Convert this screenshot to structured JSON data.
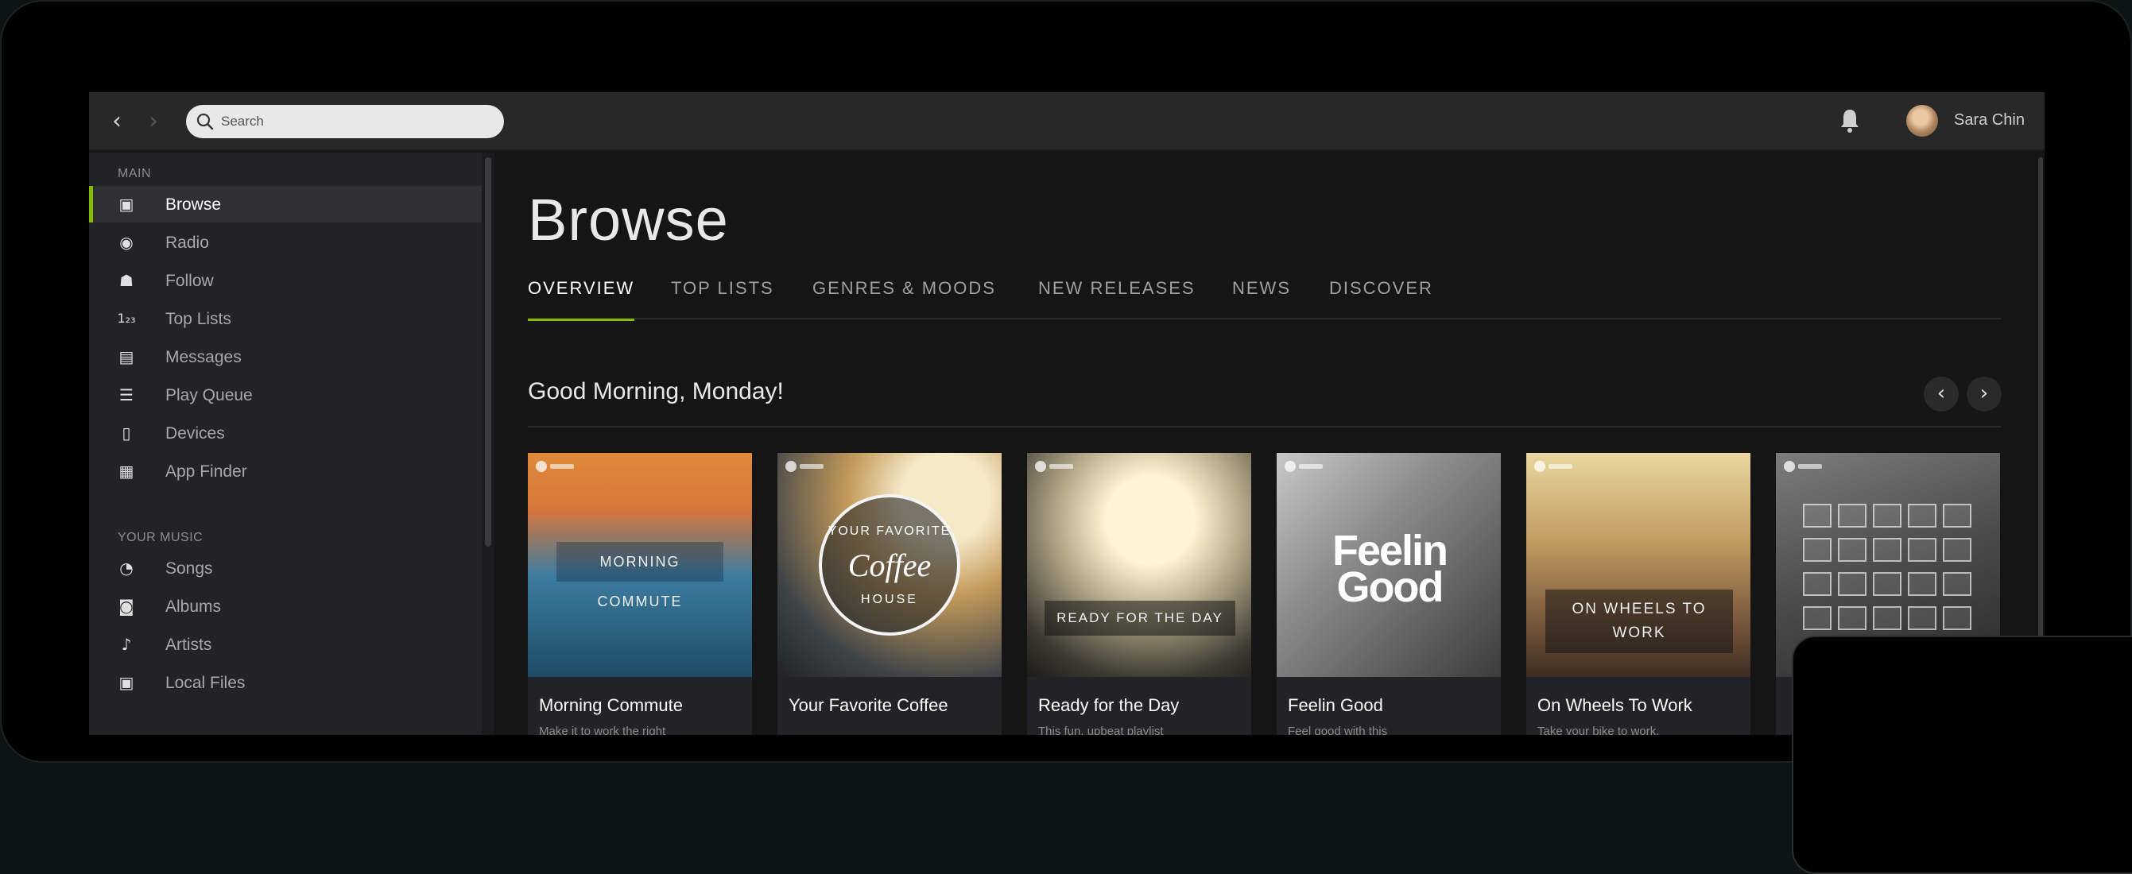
{
  "topbar": {
    "search_placeholder": "Search",
    "username": "Sara Chin"
  },
  "sidebar": {
    "main_label": "MAIN",
    "main_items": [
      {
        "label": "Browse",
        "icon": "browse-icon"
      },
      {
        "label": "Radio",
        "icon": "radio-icon"
      },
      {
        "label": "Follow",
        "icon": "follow-icon"
      },
      {
        "label": "Top Lists",
        "icon": "top-lists-icon"
      },
      {
        "label": "Messages",
        "icon": "messages-icon"
      },
      {
        "label": "Play Queue",
        "icon": "play-queue-icon"
      },
      {
        "label": "Devices",
        "icon": "devices-icon"
      },
      {
        "label": "App Finder",
        "icon": "app-finder-icon"
      }
    ],
    "music_label": "YOUR MUSIC",
    "music_items": [
      {
        "label": "Songs",
        "icon": "songs-icon"
      },
      {
        "label": "Albums",
        "icon": "albums-icon"
      },
      {
        "label": "Artists",
        "icon": "artists-icon"
      },
      {
        "label": "Local Files",
        "icon": "local-files-icon"
      }
    ]
  },
  "main": {
    "title": "Browse",
    "tabs": [
      "OVERVIEW",
      "TOP LISTS",
      "GENRES & MOODS",
      "NEW RELEASES",
      "NEWS",
      "DISCOVER"
    ],
    "active_tab": "OVERVIEW",
    "section_title": "Good Morning, Monday!",
    "cards": [
      {
        "title": "Morning Commute",
        "desc": "Make it to work the right",
        "cover_text": "MORNING COMMUTE"
      },
      {
        "title": "Your Favorite Coffee",
        "desc": "",
        "cover_text_top": "YOUR FAVORITE",
        "cover_text_mid": "Coffee",
        "cover_text_bottom": "HOUSE"
      },
      {
        "title": "Ready for the Day",
        "desc": "This fun, upbeat playlist",
        "cover_text": "READY FOR THE DAY"
      },
      {
        "title": "Feelin Good",
        "desc": "Feel good with this",
        "cover_text": "Feelin Good"
      },
      {
        "title": "On Wheels To Work",
        "desc": "Take your bike to work,",
        "cover_text": "ON WHEELS TO WORK"
      },
      {
        "title": "",
        "desc": ""
      }
    ]
  },
  "colors": {
    "accent": "#84bd00",
    "topbar": "#282828",
    "sidebar": "#222326",
    "main": "#151516"
  }
}
